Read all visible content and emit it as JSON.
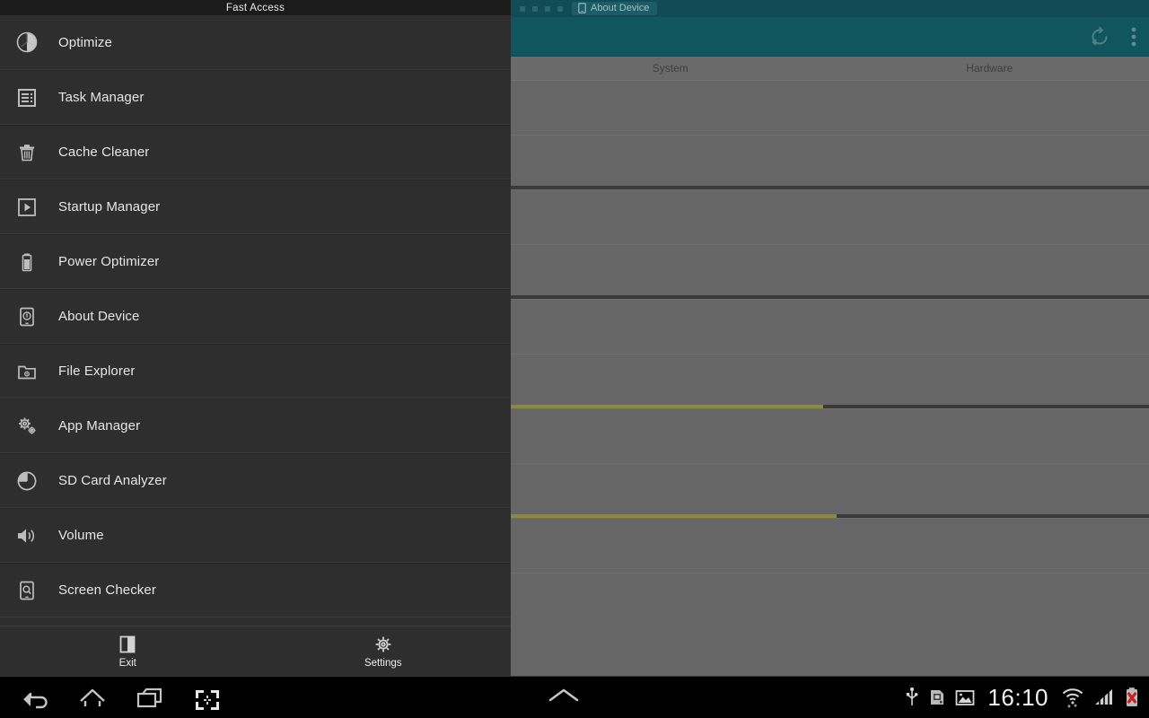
{
  "left_panel": {
    "title": "Fast Access",
    "menu_items": [
      {
        "label": "Optimize",
        "icon": "pie-clock-icon"
      },
      {
        "label": "Task Manager",
        "icon": "list-document-icon"
      },
      {
        "label": "Cache Cleaner",
        "icon": "trash-icon"
      },
      {
        "label": "Startup Manager",
        "icon": "play-square-icon"
      },
      {
        "label": "Power Optimizer",
        "icon": "battery-icon"
      },
      {
        "label": "About Device",
        "icon": "device-info-icon"
      },
      {
        "label": "File Explorer",
        "icon": "folder-gear-icon"
      },
      {
        "label": "App Manager",
        "icon": "gears-icon"
      },
      {
        "label": "SD Card Analyzer",
        "icon": "pie-chart-icon"
      },
      {
        "label": "Volume",
        "icon": "speaker-icon"
      },
      {
        "label": "Screen Checker",
        "icon": "screen-search-icon"
      }
    ],
    "bottom_actions": [
      {
        "label": "Exit",
        "icon": "exit-door-icon"
      },
      {
        "label": "Settings",
        "icon": "gear-icon"
      }
    ]
  },
  "right_panel": {
    "tab": {
      "label": "About Device",
      "icon": "phone-icon"
    },
    "action_bar": {
      "refresh_icon": "refresh-icon",
      "overflow_icon": "overflow-menu-icon"
    },
    "section_tabs": [
      {
        "label": "System"
      },
      {
        "label": "Hardware"
      }
    ],
    "info_rows": [
      {
        "bar_visible": false,
        "fill_percent": 0,
        "track_percent": 0
      },
      {
        "bar_visible": true,
        "fill_percent": 0,
        "track_percent": 100
      },
      {
        "bar_visible": false,
        "fill_percent": 0,
        "track_percent": 0
      },
      {
        "bar_visible": true,
        "fill_percent": 0,
        "track_percent": 100
      },
      {
        "bar_visible": false,
        "fill_percent": 0,
        "track_percent": 0
      },
      {
        "bar_visible": true,
        "fill_percent": 49,
        "track_percent": 100
      },
      {
        "bar_visible": false,
        "fill_percent": 0,
        "track_percent": 0
      },
      {
        "bar_visible": true,
        "fill_percent": 51,
        "track_percent": 100
      },
      {
        "bar_visible": false,
        "fill_percent": 0,
        "track_percent": 0
      }
    ]
  },
  "navbar": {
    "buttons": [
      {
        "name": "back",
        "icon": "back-arrow-icon"
      },
      {
        "name": "home",
        "icon": "home-icon"
      },
      {
        "name": "recents",
        "icon": "recents-icon"
      },
      {
        "name": "screenshot",
        "icon": "screenshot-icon"
      }
    ],
    "center": {
      "icon": "chevron-up-icon"
    },
    "tray": [
      {
        "name": "usb",
        "icon": "usb-icon"
      },
      {
        "name": "sd-card",
        "icon": "sd-card-icon"
      },
      {
        "name": "screenshot-notification",
        "icon": "image-icon"
      }
    ],
    "clock": "16:10",
    "status": [
      {
        "name": "wifi",
        "icon": "wifi-icon"
      },
      {
        "name": "signal",
        "icon": "signal-bars-icon"
      },
      {
        "name": "battery",
        "icon": "battery-error-icon"
      }
    ]
  },
  "colors": {
    "panel_dark": "#2e2e2e",
    "titlebar": "#1b1b1b",
    "teal_action_bar": "#11555f",
    "teal_tab_strip": "#114b55",
    "right_content": "#666666",
    "bar_fill": "#8a8a3f",
    "bar_track": "#3a3a3a",
    "battery_error": "#cc2222"
  }
}
